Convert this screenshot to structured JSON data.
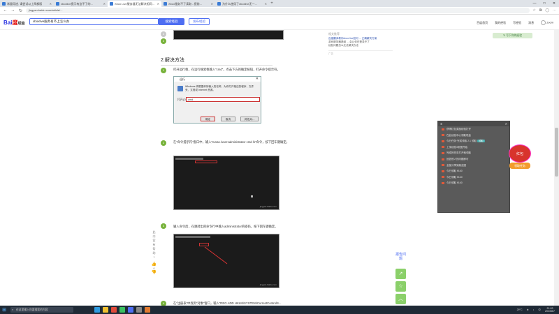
{
  "browser": {
    "tabs": [
      {
        "label": "常量用途, 请尝试以上两都版",
        "active": false
      },
      {
        "label": "xboxlive提示有这不了的...",
        "active": false
      },
      {
        "label": "Xbox Live服务器无法解决相同问题",
        "active": true
      },
      {
        "label": "Xbox服务不了读取 - 提前...",
        "active": false
      },
      {
        "label": "为什么使用了xboxlive无一...",
        "active": false
      }
    ],
    "new_tab": "+",
    "url": "jingyan.baidu.com/article/...",
    "window_controls": [
      "—",
      "□",
      "✕"
    ]
  },
  "baidu": {
    "logo_text": "Bai",
    "logo_red": "度",
    "logo_suffix": "经验",
    "search_value": "xboxlive服务有不上怎么办",
    "search_button": "搜索经验",
    "post_button": "发布经验",
    "nav": [
      "百度首页",
      "我的经验",
      "写经验",
      "消息",
      "zoom"
    ]
  },
  "article": {
    "section_title": "2.解决方法",
    "steps": [
      {
        "num": "1",
        "text": "打开运行框，在运行搜索框输入“cmd”，点击下方的确定按钮，打开命令提示符。"
      },
      {
        "num": "2",
        "text": "在“命令提示符”窗口中，输入“runas /user:administrator cmd /k”命令，按下回车键确定。"
      },
      {
        "num": "3",
        "text": "输入命令后，在跳转出的命令行中输入administrator的密码，按下回车键确定。"
      },
      {
        "num": "4",
        "text": "在“注册表”中找到“对象”窗口，输入“REG ADD HKLM\\SYSTEM\\CurrentControlS..."
      }
    ],
    "watermark": "jingyan.baidu.com",
    "run_dialog": {
      "title": "运行",
      "desc": "Windows 将根据你所输入的名称，为你打开相应的程序、文件夹、文档或 Internet 资源。",
      "open_label": "打开(O):",
      "input_value": "cmd",
      "ok": "确定",
      "cancel": "取消",
      "browse": "浏览(B)..."
    }
  },
  "right_card": {
    "title": "相关推荐",
    "lines": [
      "百度翻译教你xbox live如何 ... 正确解决方案",
      "游戏服务器错误 ... 会让你在登录不了",
      "经验问题怎么无法解决办法"
    ],
    "ad": "广告",
    "button": "✎ 写下你的经验"
  },
  "left_bar": {
    "labels": [
      "此",
      "内",
      "容",
      "有",
      "帮",
      "助",
      "?"
    ],
    "count": "0"
  },
  "popup": {
    "header_left": "⊕",
    "header_right": "✕",
    "rows": [
      "获得红包奖励经验打开",
      "在此经验中心领取现金",
      "今日任务·完成领取 2.1 领取",
      "上传经验3张图开始",
      "完成的任务打开就领取",
      "回答别人的问题即可",
      "全部分享到朋友圈",
      "今日领取 ¥140",
      "今日领取 ¥140",
      "今日领取 ¥140"
    ],
    "tag": "领取"
  },
  "redpack": {
    "label": "红包",
    "badge": "领取任务"
  },
  "side_buttons": {
    "feedback": "报告问题",
    "share": "↗",
    "star": "☆",
    "top": "︿"
  },
  "taskbar": {
    "search_placeholder": "在这里输入你要搜索的内容",
    "weather": "29°C",
    "time": "21:03",
    "date": "2023/8/7",
    "lang": "中"
  }
}
